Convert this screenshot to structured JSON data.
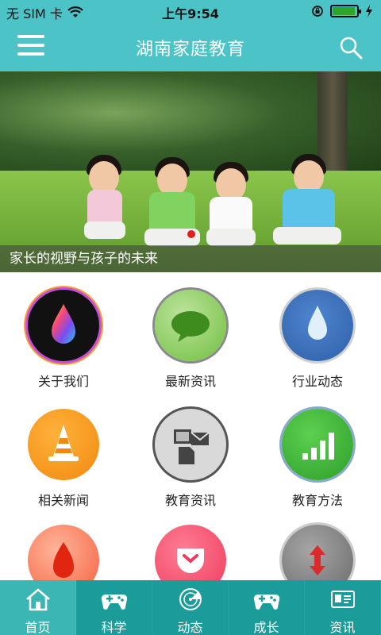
{
  "status_bar": {
    "carrier": "无 SIM 卡",
    "time": "上午9:54",
    "icons": [
      "wifi-icon",
      "rotation-lock-icon",
      "battery-icon",
      "charging-icon"
    ]
  },
  "app_bar": {
    "title": "湖南家庭教育",
    "menu_icon": "hamburger-menu-icon",
    "search_icon": "search-icon",
    "color": "#4bc3c7"
  },
  "banner": {
    "caption": "家长的视野与孩子的未来"
  },
  "grid": {
    "items": [
      {
        "label": "关于我们",
        "icon": "rainbow-drop-icon"
      },
      {
        "label": "最新资讯",
        "icon": "chat-bubble-icon"
      },
      {
        "label": "行业动态",
        "icon": "water-drop-icon"
      },
      {
        "label": "相关新闻",
        "icon": "traffic-cone-icon"
      },
      {
        "label": "教育资讯",
        "icon": "documents-icon"
      },
      {
        "label": "教育方法",
        "icon": "signal-bars-icon"
      },
      {
        "label": "",
        "icon": "flame-icon"
      },
      {
        "label": "",
        "icon": "pocket-icon"
      },
      {
        "label": "",
        "icon": "up-down-arrows-icon"
      }
    ]
  },
  "tab_bar": {
    "tabs": [
      {
        "label": "首页",
        "icon": "home-icon",
        "active": true
      },
      {
        "label": "科学",
        "icon": "gamepad-icon",
        "active": false
      },
      {
        "label": "动态",
        "icon": "radar-icon",
        "active": false
      },
      {
        "label": "成长",
        "icon": "gamepad-icon",
        "active": false
      },
      {
        "label": "资讯",
        "icon": "id-card-icon",
        "active": false
      }
    ],
    "color": "#1c9b9b",
    "active_color": "#3cb6b4"
  }
}
